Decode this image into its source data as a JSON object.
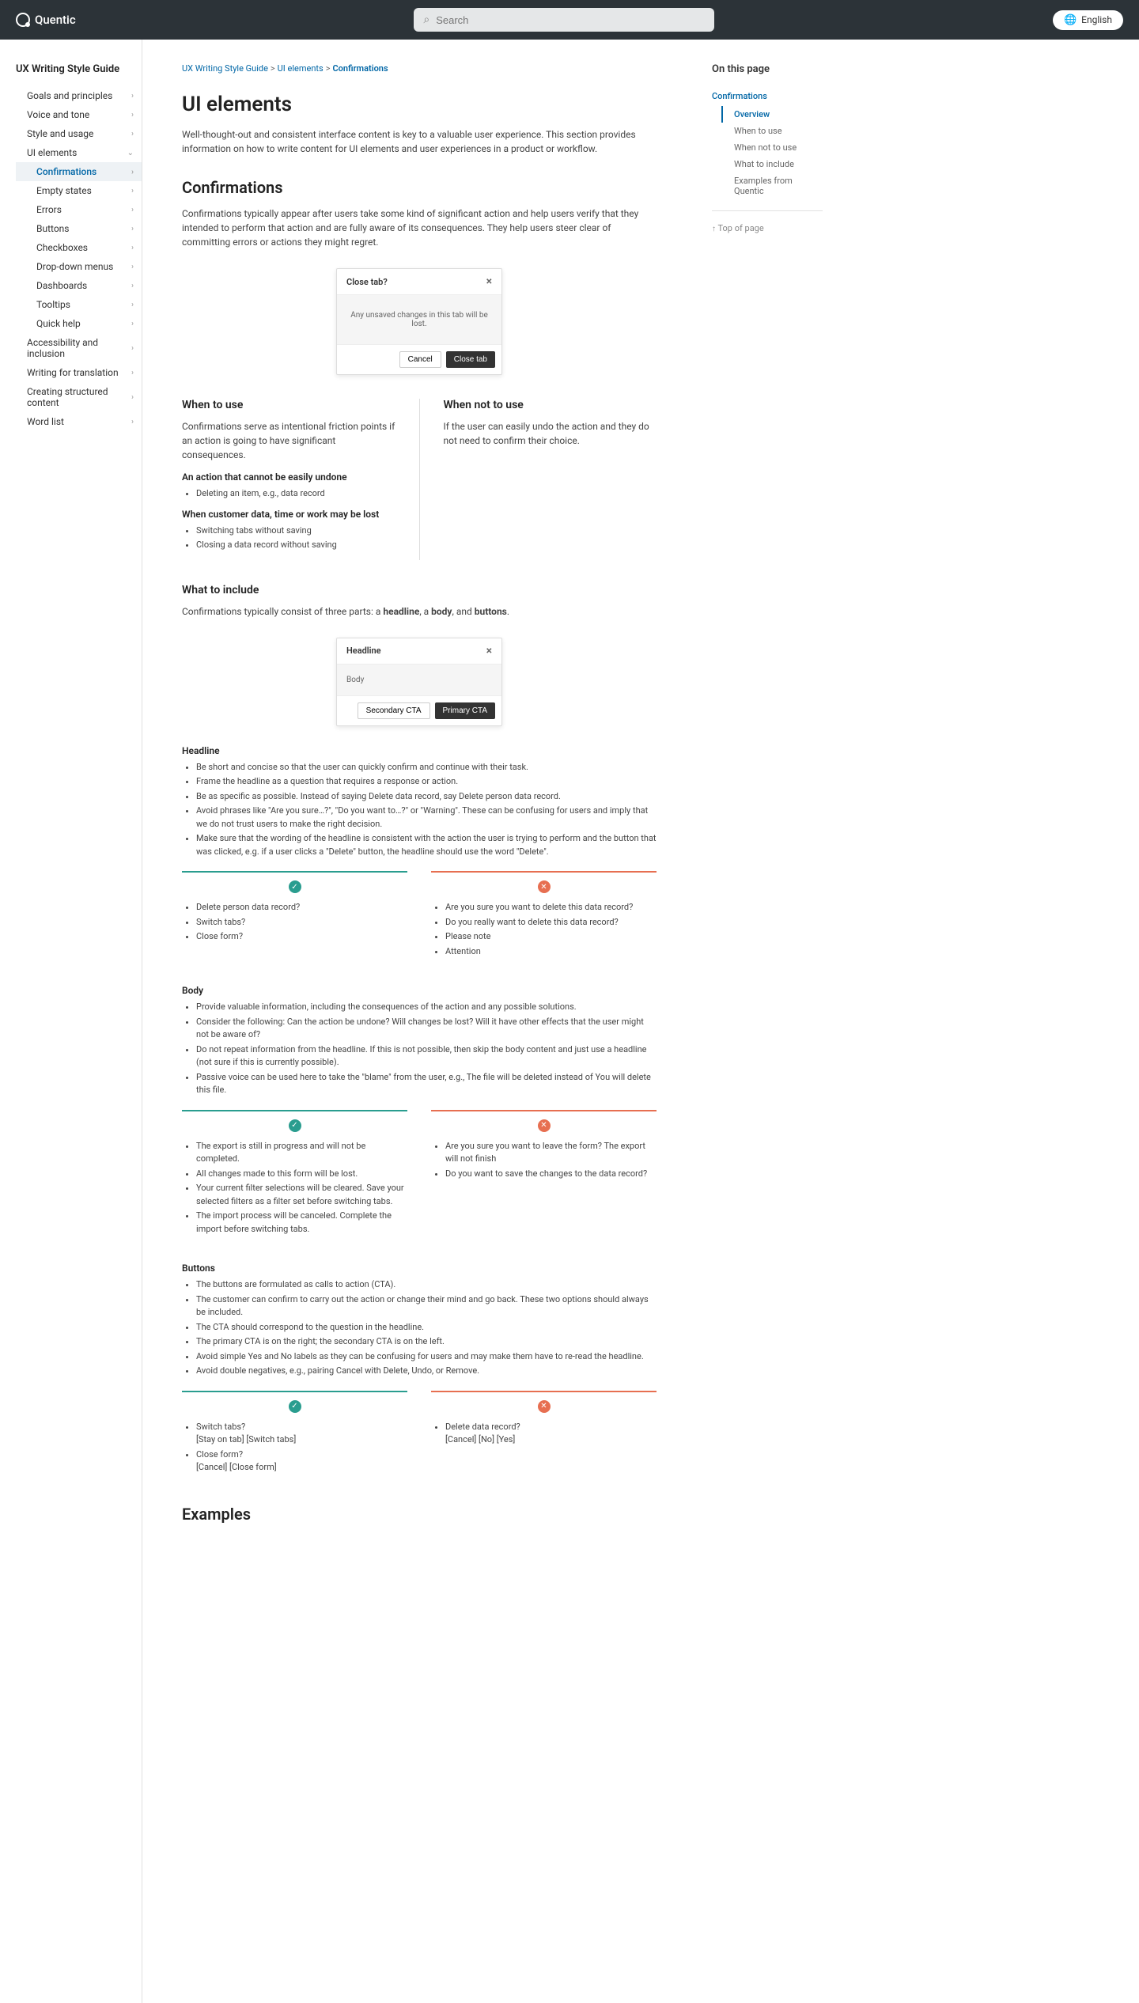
{
  "header": {
    "brand": "Quentic",
    "search_placeholder": "Search",
    "language": "English"
  },
  "sidebar": {
    "title": "UX Writing Style Guide",
    "items": [
      {
        "label": "Goals and principles",
        "sub": false,
        "active": false
      },
      {
        "label": "Voice and tone",
        "sub": false,
        "active": false
      },
      {
        "label": "Style and usage",
        "sub": false,
        "active": false
      },
      {
        "label": "UI elements",
        "sub": false,
        "active": false,
        "open": true
      },
      {
        "label": "Confirmations",
        "sub": true,
        "active": true
      },
      {
        "label": "Empty states",
        "sub": true,
        "active": false
      },
      {
        "label": "Errors",
        "sub": true,
        "active": false
      },
      {
        "label": "Buttons",
        "sub": true,
        "active": false
      },
      {
        "label": "Checkboxes",
        "sub": true,
        "active": false
      },
      {
        "label": "Drop-down menus",
        "sub": true,
        "active": false
      },
      {
        "label": "Dashboards",
        "sub": true,
        "active": false
      },
      {
        "label": "Tooltips",
        "sub": true,
        "active": false
      },
      {
        "label": "Quick help",
        "sub": true,
        "active": false
      },
      {
        "label": "Accessibility and inclusion",
        "sub": false,
        "active": false
      },
      {
        "label": "Writing for translation",
        "sub": false,
        "active": false
      },
      {
        "label": "Creating structured content",
        "sub": false,
        "active": false
      },
      {
        "label": "Word list",
        "sub": false,
        "active": false
      }
    ]
  },
  "breadcrumb": {
    "p1": "UX Writing Style Guide",
    "p2": "UI elements",
    "p3": "Confirmations"
  },
  "page": {
    "title": "UI elements",
    "intro": "Well-thought-out and consistent interface content is key to a valuable user experience. This section provides information on how to write content for UI elements and user experiences in a product or workflow.",
    "h2_confirmations": "Confirmations",
    "confirmations_intro": "Confirmations typically appear after users take some kind of significant action and help users verify that they intended to perform that action and are fully aware of its consequences. They help users steer clear of committing errors or actions they might regret.",
    "dialog1": {
      "title": "Close tab?",
      "body": "Any unsaved changes in this tab will be lost.",
      "sec": "Cancel",
      "pri": "Close tab"
    },
    "when_to": {
      "title": "When to use",
      "p": "Confirmations serve as intentional friction points if an action is going to have significant consequences.",
      "h4a": "An action that cannot be easily undone",
      "li_a1": "Deleting an item, e.g., data record",
      "h4b": "When customer data, time or work may be lost",
      "li_b1": "Switching tabs without saving",
      "li_b2": "Closing a data record without saving"
    },
    "when_not": {
      "title": "When not to use",
      "p": "If the user can easily undo the action and they do not need to confirm their choice."
    },
    "what_include": {
      "title": "What to include",
      "p_pre": "Confirmations typically consist of three parts: a ",
      "b1": "headline",
      "mid1": ", a ",
      "b2": "body",
      "mid2": ", and ",
      "b3": "buttons",
      "end": "."
    },
    "dialog2": {
      "title": "Headline",
      "body": "Body",
      "sec": "Secondary CTA",
      "pri": "Primary CTA"
    },
    "headline": {
      "title": "Headline",
      "li1": "Be short and concise so that the user can quickly confirm and continue with their task.",
      "li2": "Frame the headline as a question that requires a response or action.",
      "li3": "Be as specific as possible. Instead of saying Delete data record, say Delete person data record.",
      "li4": "Avoid phrases like \"Are you sure…?\", \"Do you want to…?\" or \"Warning\". These can be confusing for users and imply that we do not trust users to make the right decision.",
      "li5": "Make sure that the wording of the headline is consistent with the action the user is trying to perform and the button that was clicked, e.g. if a user clicks a \"Delete\" button, the headline should use the word \"Delete\".",
      "do1": "Delete person data record?",
      "do2": "Switch tabs?",
      "do3": "Close form?",
      "dont1": "Are you sure you want to delete this data record?",
      "dont2": "Do you really want to delete this data record?",
      "dont3": "Please note",
      "dont4": "Attention"
    },
    "body": {
      "title": "Body",
      "li1": "Provide valuable information, including the consequences of the action and any possible solutions.",
      "li2": "Consider the following: Can the action be undone? Will changes be lost? Will it have other effects that the user might not be aware of?",
      "li3": "Do not repeat information from the headline. If this is not possible, then skip the body content and just use a headline (not sure if this is currently possible).",
      "li4": "Passive voice can be used here to take the \"blame\" from the user, e.g., The file will be deleted instead of You will delete this file.",
      "do1": "The export is still in progress and will not be completed.",
      "do2": "All changes made to this form will be lost.",
      "do3": "Your current filter selections will be cleared. Save your selected filters as a filter set before switching tabs.",
      "do4": "The import process will be canceled. Complete the import before switching tabs.",
      "dont1": "Are you sure you want to leave the form? The export will not finish",
      "dont2": "Do you want to save the changes to the data record?"
    },
    "buttons": {
      "title": "Buttons",
      "li1": "The buttons are formulated as calls to action (CTA).",
      "li2": "The customer can confirm to carry out the action or change their mind and go back. These two options should always be included.",
      "li3": "The CTA should correspond to the question in the headline.",
      "li4": "The primary CTA is on the right; the secondary CTA is on the left.",
      "li5": "Avoid simple Yes and No labels as they can be confusing for users and may make them have to re-read the headline.",
      "li6": "Avoid double negatives, e.g., pairing Cancel with Delete, Undo, or Remove.",
      "do1a": "Switch tabs?",
      "do1b": "[Stay on tab] [Switch tabs]",
      "do2a": "Close form?",
      "do2b": "[Cancel] [Close form]",
      "dont1a": "Delete data record?",
      "dont1b": "[Cancel] [No] [Yes]"
    },
    "examples_title": "Examples"
  },
  "toc": {
    "title": "On this page",
    "section": "Confirmations",
    "items": [
      {
        "label": "Overview",
        "active": true
      },
      {
        "label": "When to use",
        "active": false
      },
      {
        "label": "When not to use",
        "active": false
      },
      {
        "label": "What to include",
        "active": false
      },
      {
        "label": "Examples from Quentic",
        "active": false
      }
    ],
    "top": "Top of page"
  }
}
